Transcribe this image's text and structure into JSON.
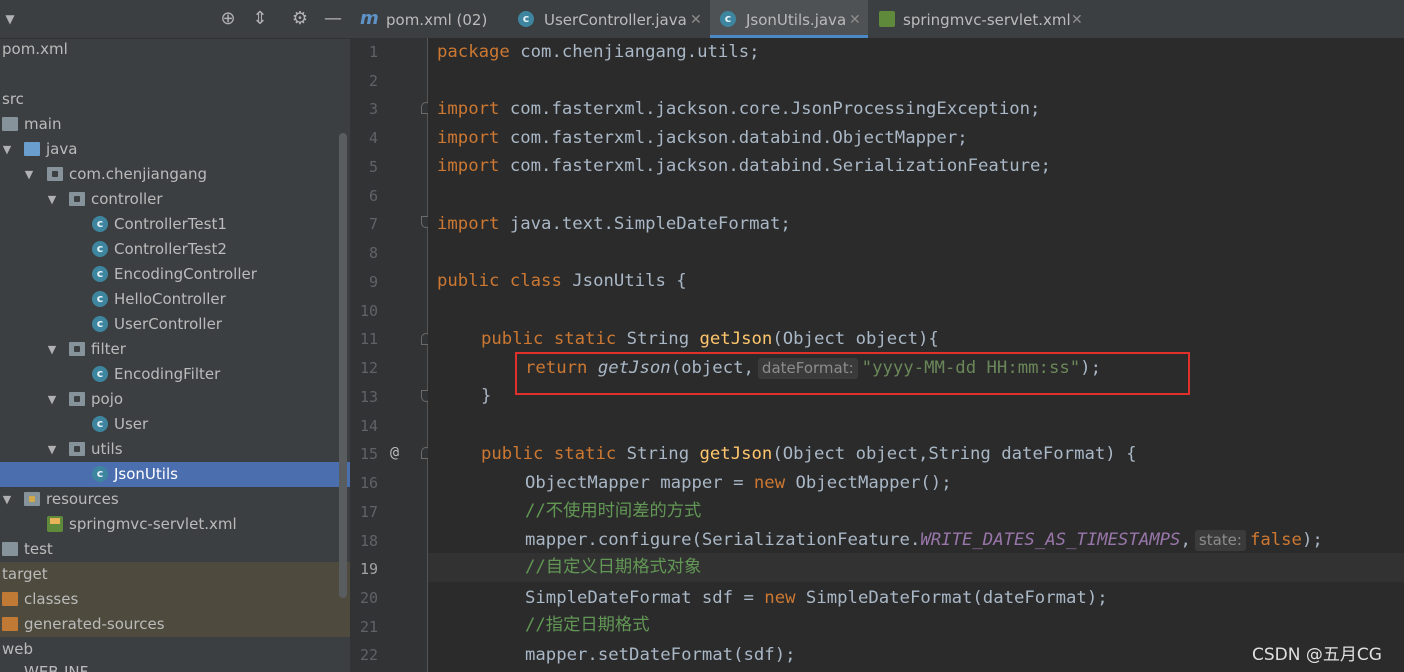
{
  "project": {
    "tree": [
      {
        "label": "pom.xml",
        "icon": "maven-file-icon",
        "arrow": ""
      },
      {
        "label": "",
        "icon": "",
        "arrow": ""
      },
      {
        "label": "src",
        "icon": "",
        "arrow": ""
      },
      {
        "label": "main",
        "icon": "folder-icon",
        "arrow": ""
      },
      {
        "label": "java",
        "icon": "source-folder-icon",
        "arrow": "▼"
      },
      {
        "label": "com.chenjiangang",
        "icon": "package-icon",
        "arrow": "▼"
      },
      {
        "label": "controller",
        "icon": "package-icon",
        "arrow": "▼"
      },
      {
        "label": "ControllerTest1",
        "icon": "class-icon",
        "arrow": ""
      },
      {
        "label": "ControllerTest2",
        "icon": "class-icon",
        "arrow": ""
      },
      {
        "label": "EncodingController",
        "icon": "class-icon",
        "arrow": ""
      },
      {
        "label": "HelloController",
        "icon": "class-icon",
        "arrow": ""
      },
      {
        "label": "UserController",
        "icon": "class-icon",
        "arrow": ""
      },
      {
        "label": "filter",
        "icon": "package-icon",
        "arrow": "▼"
      },
      {
        "label": "EncodingFilter",
        "icon": "class-icon",
        "arrow": ""
      },
      {
        "label": "pojo",
        "icon": "package-icon",
        "arrow": "▼"
      },
      {
        "label": "User",
        "icon": "class-icon",
        "arrow": ""
      },
      {
        "label": "utils",
        "icon": "package-icon",
        "arrow": "▼"
      },
      {
        "label": "JsonUtils",
        "icon": "class-icon",
        "arrow": ""
      },
      {
        "label": "resources",
        "icon": "resources-folder-icon",
        "arrow": "▼"
      },
      {
        "label": "springmvc-servlet.xml",
        "icon": "spring-xml-icon",
        "arrow": ""
      },
      {
        "label": "test",
        "icon": "folder-icon",
        "arrow": ""
      },
      {
        "label": "target",
        "icon": "",
        "arrow": ""
      },
      {
        "label": "classes",
        "icon": "excluded-folder-icon",
        "arrow": ""
      },
      {
        "label": "generated-sources",
        "icon": "excluded-folder-icon",
        "arrow": ""
      },
      {
        "label": "web",
        "icon": "",
        "arrow": ""
      },
      {
        "label": "WEB-INF",
        "icon": "",
        "arrow": ""
      }
    ],
    "selected": "JsonUtils"
  },
  "tabs": [
    {
      "label": "pom.xml (02)",
      "icon": "maven-m-icon",
      "active": false
    },
    {
      "label": "UserController.java",
      "icon": "class-icon",
      "active": false
    },
    {
      "label": "JsonUtils.java",
      "icon": "class-icon",
      "active": true
    },
    {
      "label": "springmvc-servlet.xml",
      "icon": "spring-xml-icon",
      "active": false
    }
  ],
  "editor": {
    "line_numbers": [
      "1",
      "2",
      "3",
      "4",
      "5",
      "6",
      "7",
      "8",
      "9",
      "10",
      "11",
      "12",
      "13",
      "14",
      "15",
      "16",
      "17",
      "18",
      "19",
      "20",
      "21",
      "22"
    ],
    "current_line": "19",
    "override_marker": "@",
    "code": {
      "l1_kw": "package",
      "l1_rest": " com.chenjiangang.utils;",
      "import_kw": "import",
      "l3_rest": " com.fasterxml.jackson.core.JsonProcessingException;",
      "l4_rest": " com.fasterxml.jackson.databind.ObjectMapper;",
      "l5_rest": " com.fasterxml.jackson.databind.SerializationFeature;",
      "l7_rest": " java.text.SimpleDateFormat;",
      "l9_kw": "public class",
      "l9_rest": " JsonUtils {",
      "public_static": "public static",
      "l11_type": " String ",
      "l11_fn": "getJson",
      "l11_rest": "(Object object){",
      "l12_kw": "return",
      "l12_fn": "getJson",
      "l12_a": "(object,",
      "l12_hint": "dateFormat:",
      "l12_str": "\"yyyy-MM-dd HH:mm:ss\"",
      "l12_end": ");",
      "l13": "}",
      "l15_type": " String ",
      "l15_fn": "getJson",
      "l15_rest": "(Object object,String dateFormat) {",
      "l16_a": "ObjectMapper mapper = ",
      "new_kw": "new",
      "l16_b": " ObjectMapper();",
      "l17_cm": "//不使用时间差的方式",
      "l18_a": "mapper.configure(SerializationFeature.",
      "l18_const": "WRITE_DATES_AS_TIMESTAMPS",
      "l18_b": ",",
      "l18_hint": "state:",
      "l18_kw": "false",
      "l18_end": ");",
      "l19_cm": "//自定义日期格式对象",
      "l20_a": "SimpleDateFormat sdf = ",
      "l20_b": " SimpleDateFormat(dateFormat);",
      "l21_cm": "//指定日期格式",
      "l22": "mapper.setDateFormat(sdf);"
    }
  },
  "watermark": "CSDN @五月CG"
}
